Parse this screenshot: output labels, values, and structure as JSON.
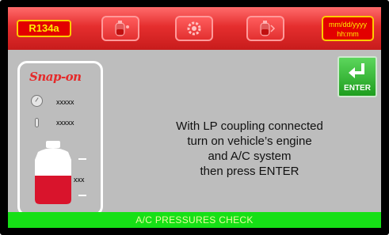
{
  "topbar": {
    "refrigerant_label": "R134a",
    "buttons": [
      {
        "icon": "tank-level-icon"
      },
      {
        "icon": "settings-gear-icon"
      },
      {
        "icon": "tank-fill-icon"
      }
    ],
    "datetime_line1": "mm/dd/yyyy",
    "datetime_line2": "hh:mm"
  },
  "side_panel": {
    "brand": "Snap-on",
    "pressure_value": "xxxxx",
    "temperature_value": "xxxxx",
    "tank_value": "xxx"
  },
  "enter_button": {
    "label": "ENTER"
  },
  "message": {
    "lines": [
      "With LP coupling connected",
      "turn on vehicle’s engine",
      "and A/C system",
      "then press ENTER"
    ]
  },
  "status_bar": {
    "text": "A/C PRESSURES CHECK"
  },
  "colors": {
    "topbar_red": "#e52e2e",
    "accent_yellow": "#ffee00",
    "status_green": "#16e016",
    "enter_green": "#2eb82e",
    "screen_gray": "#bdbdbd"
  }
}
